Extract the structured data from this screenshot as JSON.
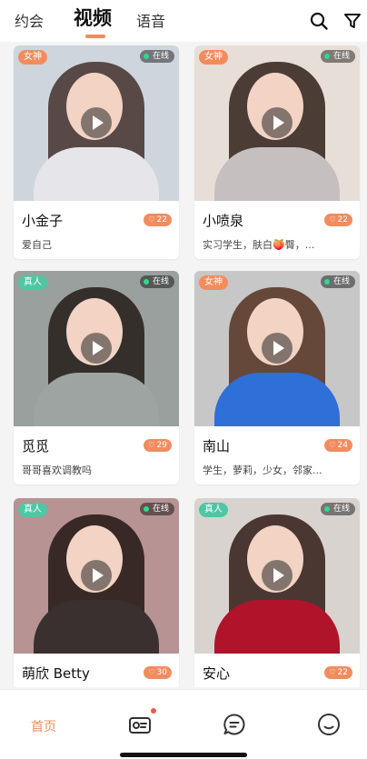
{
  "header": {
    "tabs": [
      {
        "label": "约会"
      },
      {
        "label": "视频"
      },
      {
        "label": "语音"
      }
    ],
    "active_tab": "视频",
    "icons": [
      "search-icon",
      "filter-icon"
    ]
  },
  "cards": [
    {
      "tag": "女神",
      "tag_type": "goddess",
      "status": "在线",
      "name": "小金子",
      "likes": "22",
      "bio": "爱自己",
      "palette": [
        "#cfd5dc",
        "#4a3a35",
        "#e6e6ea"
      ]
    },
    {
      "tag": "女神",
      "tag_type": "goddess",
      "status": "在线",
      "name": "小喷泉",
      "likes": "22",
      "bio": "实习学生，肤白🍑臀，...",
      "palette": [
        "#e7ded7",
        "#3a2a24",
        "#c6bfc0"
      ]
    },
    {
      "tag": "真人",
      "tag_type": "real",
      "status": "在线",
      "name": "觅觅",
      "likes": "29",
      "bio": "哥哥喜欢调教吗",
      "palette": [
        "#9aa09d",
        "#2a2220",
        "#9ea4a1"
      ]
    },
    {
      "tag": "女神",
      "tag_type": "goddess",
      "status": "在线",
      "name": "南山",
      "likes": "24",
      "bio": "学生，萝莉，少女，邻家...",
      "palette": [
        "#c6c7c6",
        "#5a3a2a",
        "#2e6fd8"
      ]
    },
    {
      "tag": "真人",
      "tag_type": "real",
      "status": "在线",
      "name": "萌欣 Betty",
      "likes": "30",
      "bio": "",
      "palette": [
        "#b79393",
        "#2a1e1c",
        "#3a3030"
      ]
    },
    {
      "tag": "真人",
      "tag_type": "real",
      "status": "在线",
      "name": "安心",
      "likes": "22",
      "bio": "",
      "palette": [
        "#d9d3d0",
        "#3a2620",
        "#b0142a"
      ]
    }
  ],
  "bottom_nav": {
    "home_label": "首页",
    "items": [
      "home-tab",
      "profile-card-icon",
      "message-icon",
      "smile-icon"
    ]
  }
}
